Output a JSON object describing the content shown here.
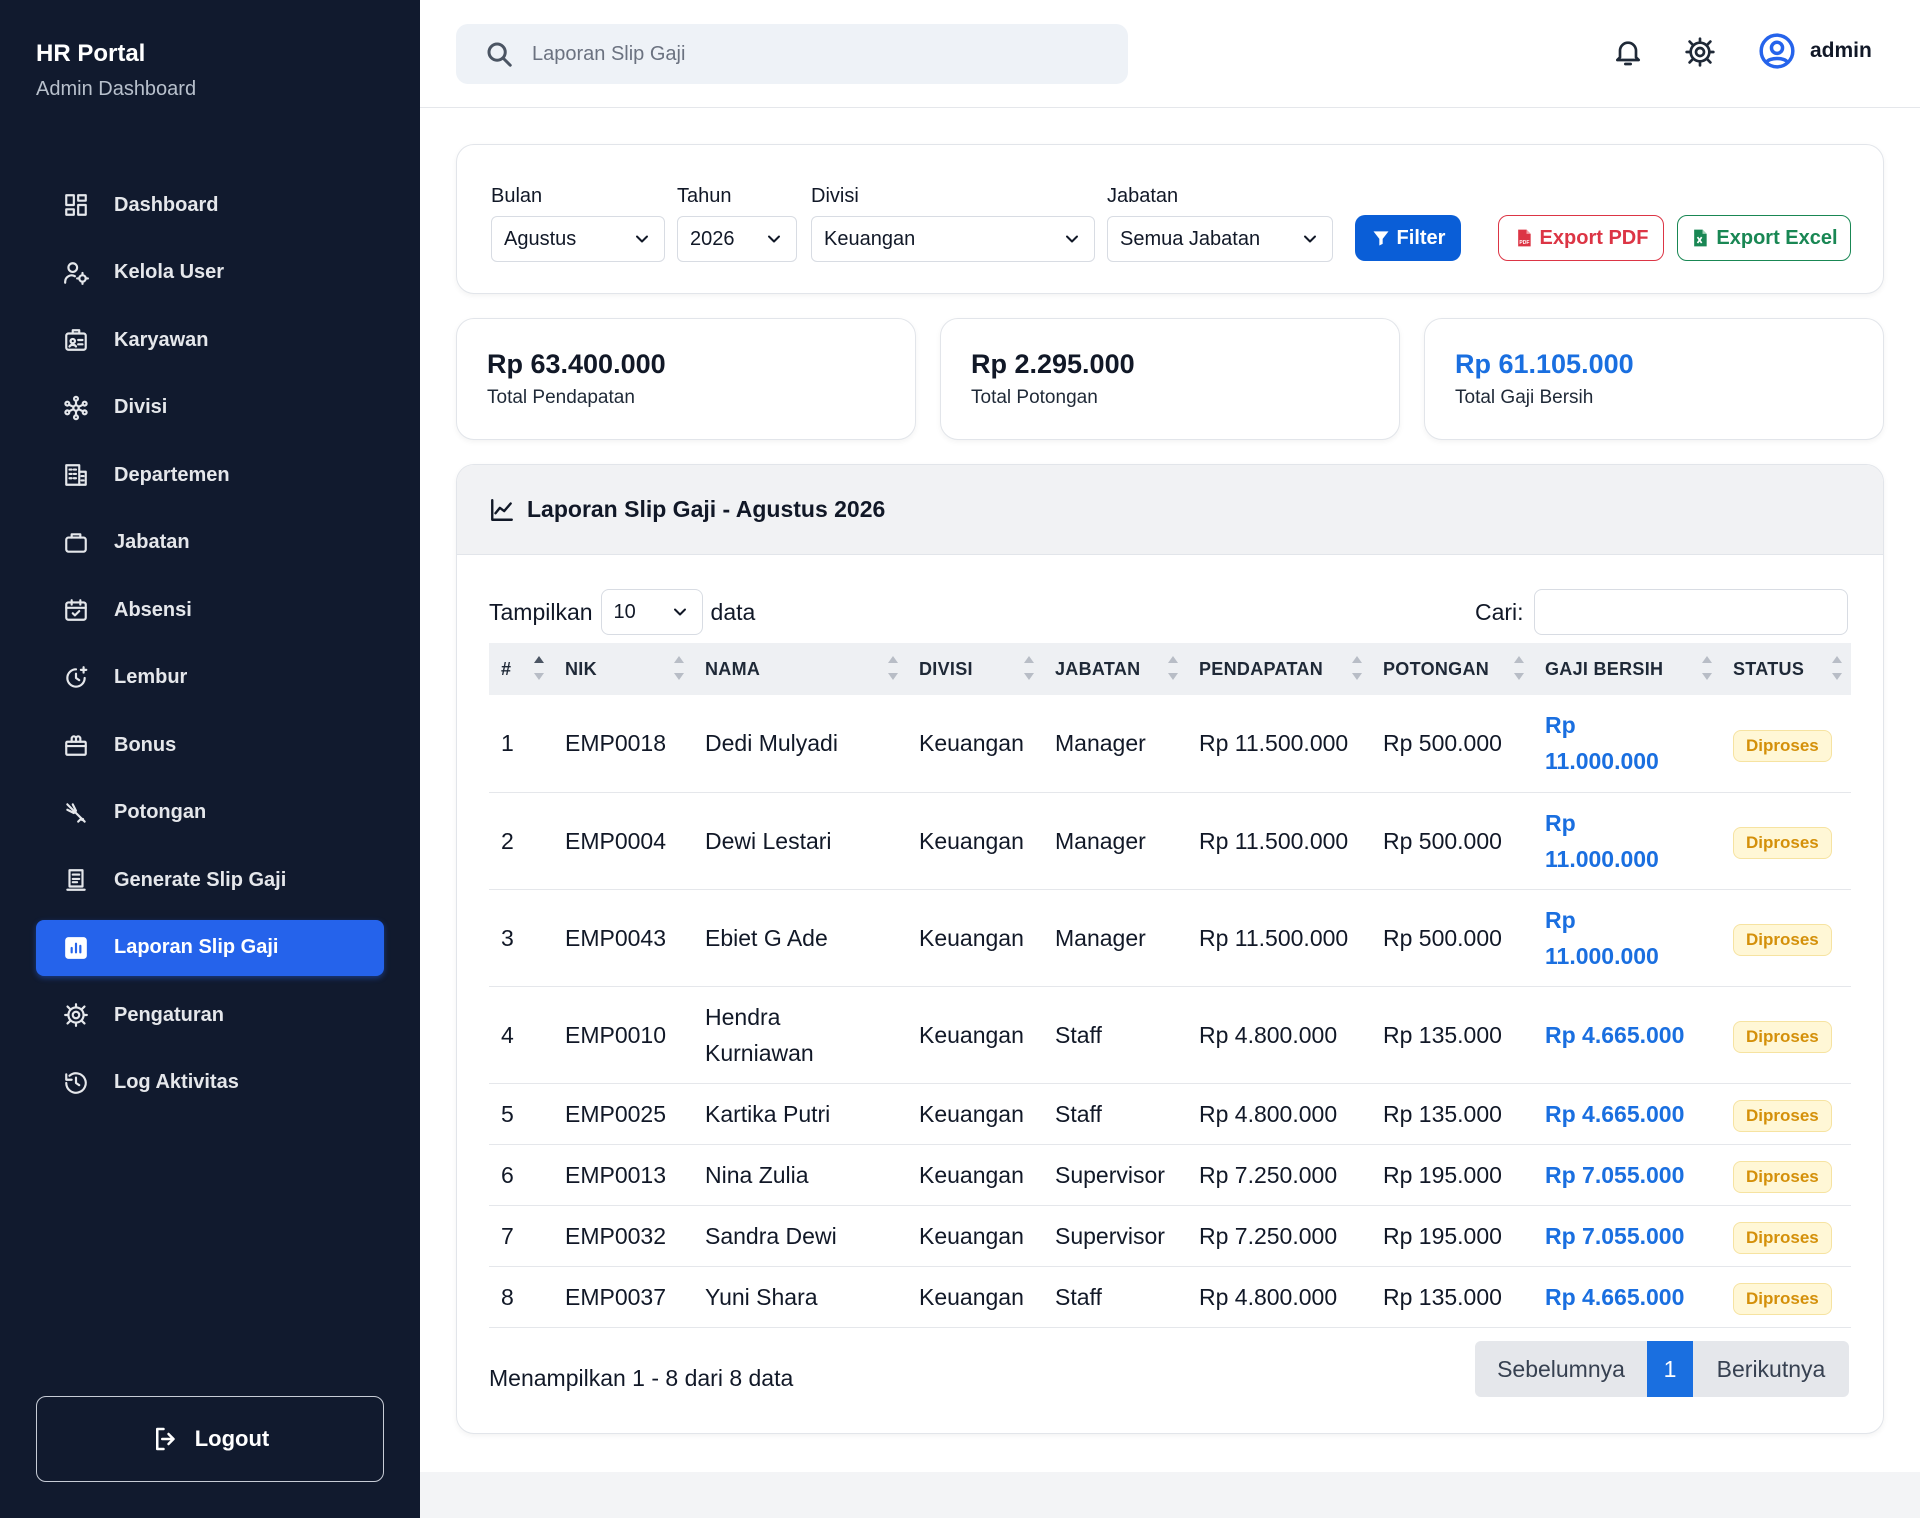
{
  "sidebar": {
    "brand_title": "HR Portal",
    "brand_subtitle": "Admin Dashboard",
    "items": [
      {
        "label": "Dashboard",
        "icon": "dashboard-icon"
      },
      {
        "label": "Kelola User",
        "icon": "user-cog-icon"
      },
      {
        "label": "Karyawan",
        "icon": "id-card-icon"
      },
      {
        "label": "Divisi",
        "icon": "network-icon"
      },
      {
        "label": "Departemen",
        "icon": "building-icon"
      },
      {
        "label": "Jabatan",
        "icon": "briefcase-icon"
      },
      {
        "label": "Absensi",
        "icon": "calendar-check-icon"
      },
      {
        "label": "Lembur",
        "icon": "clock-plus-icon"
      },
      {
        "label": "Bonus",
        "icon": "gift-icon"
      },
      {
        "label": "Potongan",
        "icon": "scissors-icon"
      },
      {
        "label": "Generate Slip Gaji",
        "icon": "receipt-icon"
      },
      {
        "label": "Laporan Slip Gaji",
        "icon": "report-chart-icon",
        "active": true
      },
      {
        "label": "Pengaturan",
        "icon": "gear-icon"
      },
      {
        "label": "Log Aktivitas",
        "icon": "history-icon"
      }
    ],
    "logout_label": "Logout"
  },
  "topbar": {
    "search_placeholder": "Laporan Slip Gaji",
    "user_name": "admin"
  },
  "filters": {
    "bulan_label": "Bulan",
    "bulan_value": "Agustus",
    "tahun_label": "Tahun",
    "tahun_value": "2026",
    "divisi_label": "Divisi",
    "divisi_value": "Keuangan",
    "jabatan_label": "Jabatan",
    "jabatan_value": "Semua Jabatan",
    "filter_button": "Filter",
    "export_pdf": "Export PDF",
    "export_excel": "Export Excel"
  },
  "stats": [
    {
      "value": "Rp 63.400.000",
      "label": "Total Pendapatan"
    },
    {
      "value": "Rp 2.295.000",
      "label": "Total Potongan"
    },
    {
      "value": "Rp 61.105.000",
      "label": "Total Gaji Bersih"
    }
  ],
  "report": {
    "title": "Laporan Slip Gaji - Agustus 2026",
    "show_prefix": "Tampilkan",
    "show_value": "10",
    "show_suffix": "data",
    "search_label": "Cari:",
    "columns": [
      "#",
      "NIK",
      "NAMA",
      "DIVISI",
      "JABATAN",
      "PENDAPATAN",
      "POTONGAN",
      "GAJI BERSIH",
      "STATUS"
    ],
    "rows": [
      {
        "no": "1",
        "nik": "EMP0018",
        "nama": "Dedi Mulyadi",
        "divisi": "Keuangan",
        "jabatan": "Manager",
        "pendapatan": "Rp 11.500.000",
        "potongan": "Rp 500.000",
        "gaji_bersih": "Rp 11.000.000",
        "status": "Diproses"
      },
      {
        "no": "2",
        "nik": "EMP0004",
        "nama": "Dewi Lestari",
        "divisi": "Keuangan",
        "jabatan": "Manager",
        "pendapatan": "Rp 11.500.000",
        "potongan": "Rp 500.000",
        "gaji_bersih": "Rp 11.000.000",
        "status": "Diproses"
      },
      {
        "no": "3",
        "nik": "EMP0043",
        "nama": "Ebiet G Ade",
        "divisi": "Keuangan",
        "jabatan": "Manager",
        "pendapatan": "Rp 11.500.000",
        "potongan": "Rp 500.000",
        "gaji_bersih": "Rp 11.000.000",
        "status": "Diproses"
      },
      {
        "no": "4",
        "nik": "EMP0010",
        "nama": "Hendra Kurniawan",
        "divisi": "Keuangan",
        "jabatan": "Staff",
        "pendapatan": "Rp 4.800.000",
        "potongan": "Rp 135.000",
        "gaji_bersih": "Rp 4.665.000",
        "status": "Diproses"
      },
      {
        "no": "5",
        "nik": "EMP0025",
        "nama": "Kartika Putri",
        "divisi": "Keuangan",
        "jabatan": "Staff",
        "pendapatan": "Rp 4.800.000",
        "potongan": "Rp 135.000",
        "gaji_bersih": "Rp 4.665.000",
        "status": "Diproses"
      },
      {
        "no": "6",
        "nik": "EMP0013",
        "nama": "Nina Zulia",
        "divisi": "Keuangan",
        "jabatan": "Supervisor",
        "pendapatan": "Rp 7.250.000",
        "potongan": "Rp 195.000",
        "gaji_bersih": "Rp 7.055.000",
        "status": "Diproses"
      },
      {
        "no": "7",
        "nik": "EMP0032",
        "nama": "Sandra Dewi",
        "divisi": "Keuangan",
        "jabatan": "Supervisor",
        "pendapatan": "Rp 7.250.000",
        "potongan": "Rp 195.000",
        "gaji_bersih": "Rp 7.055.000",
        "status": "Diproses"
      },
      {
        "no": "8",
        "nik": "EMP0037",
        "nama": "Yuni Shara",
        "divisi": "Keuangan",
        "jabatan": "Staff",
        "pendapatan": "Rp 4.800.000",
        "potongan": "Rp 135.000",
        "gaji_bersih": "Rp 4.665.000",
        "status": "Diproses"
      }
    ],
    "info": "Menampilkan 1 - 8 dari 8 data",
    "pagination": {
      "prev": "Sebelumnya",
      "current": "1",
      "next": "Berikutnya"
    }
  },
  "colors": {
    "sidebar_bg": "#111a2e",
    "accent": "#2563eb",
    "primary_button": "#0a5ed7",
    "danger": "#dc3545",
    "success": "#198754",
    "net_pay": "#1a6fe0",
    "status_warning": "#d4900a"
  }
}
